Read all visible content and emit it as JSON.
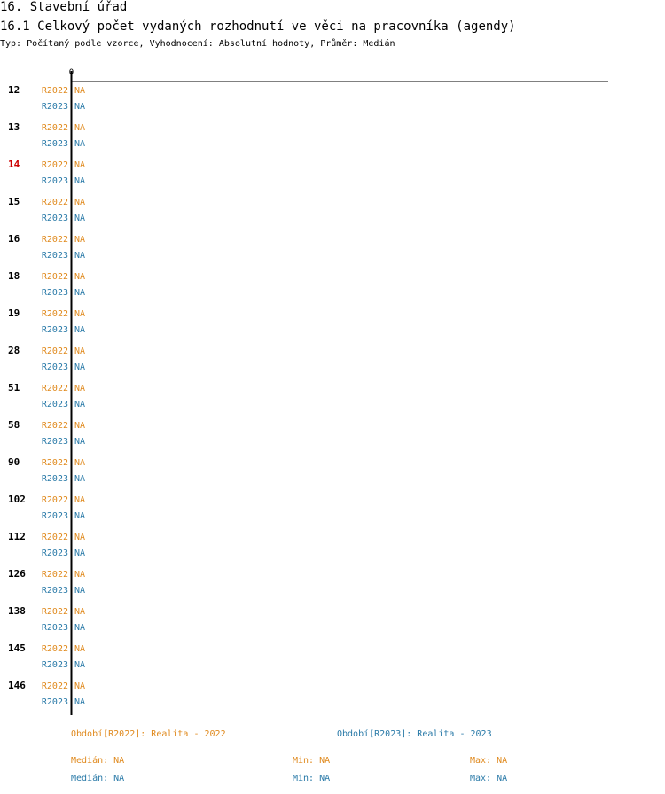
{
  "header": {
    "section_title": "16. Stavební úřad",
    "chart_title": "16.1 Celkový počet vydaných rozhodnutí ve věci na pracovníka (agendy)",
    "subtitle": "Typ: Počítaný podle vzorce, Vyhodnocení: Absolutní hodnoty, Průměr: Medián"
  },
  "colors": {
    "R2022": "#e08a1e",
    "R2023": "#2a7aa8",
    "highlight": "#cc0000",
    "text": "#000000"
  },
  "chart_data": {
    "type": "bar",
    "orientation": "horizontal",
    "x_tick_labels": [
      "0"
    ],
    "categories": [
      "12",
      "13",
      "14",
      "15",
      "16",
      "18",
      "19",
      "28",
      "51",
      "58",
      "90",
      "102",
      "112",
      "126",
      "138",
      "145",
      "146"
    ],
    "highlighted_category": "14",
    "series": [
      {
        "name": "R2022",
        "values": [
          null,
          null,
          null,
          null,
          null,
          null,
          null,
          null,
          null,
          null,
          null,
          null,
          null,
          null,
          null,
          null,
          null
        ],
        "value_labels": [
          "NA",
          "NA",
          "NA",
          "NA",
          "NA",
          "NA",
          "NA",
          "NA",
          "NA",
          "NA",
          "NA",
          "NA",
          "NA",
          "NA",
          "NA",
          "NA",
          "NA"
        ]
      },
      {
        "name": "R2023",
        "values": [
          null,
          null,
          null,
          null,
          null,
          null,
          null,
          null,
          null,
          null,
          null,
          null,
          null,
          null,
          null,
          null,
          null
        ],
        "value_labels": [
          "NA",
          "NA",
          "NA",
          "NA",
          "NA",
          "NA",
          "NA",
          "NA",
          "NA",
          "NA",
          "NA",
          "NA",
          "NA",
          "NA",
          "NA",
          "NA",
          "NA"
        ]
      }
    ],
    "grid": false
  },
  "legend": {
    "periods": [
      {
        "label": "Období[R2022]: Realita - 2022"
      },
      {
        "label": "Období[R2023]: Realita - 2023"
      }
    ],
    "stats": [
      {
        "median": "Medián: NA",
        "min": "Min: NA",
        "max": "Max: NA"
      },
      {
        "median": "Medián: NA",
        "min": "Min: NA",
        "max": "Max: NA"
      }
    ]
  }
}
